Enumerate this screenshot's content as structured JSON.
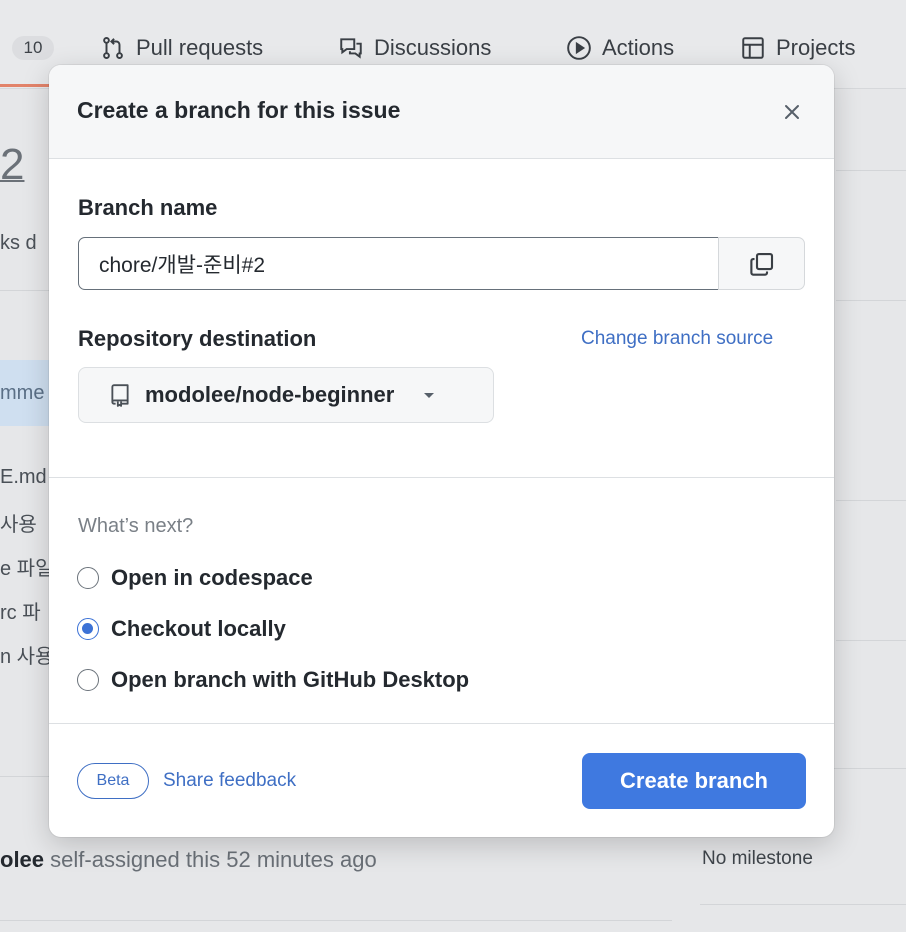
{
  "background": {
    "nav": {
      "count_badge": "10",
      "items": [
        {
          "label": "Pull requests",
          "icon": "git-pull-request-icon"
        },
        {
          "label": "Discussions",
          "icon": "comment-discussion-icon"
        },
        {
          "label": "Actions",
          "icon": "play-icon"
        },
        {
          "label": "Projects",
          "icon": "table-icon"
        }
      ]
    },
    "issue_number_fragment": "2",
    "fragments": {
      "tasks": "ks d",
      "comment_tab": "mme",
      "file_md": "E.md",
      "line_ko_1": "사용",
      "line_ko_2": "e 파일",
      "line_ko_3": "rc 파",
      "line_ko_4": "n 사용"
    },
    "activity": {
      "actor": "olee",
      "text": "self-assigned this 52 minutes ago"
    },
    "milestone": "No milestone"
  },
  "modal": {
    "title": "Create a branch for this issue",
    "branch_name": {
      "label": "Branch name",
      "value": "chore/개발-준비#2"
    },
    "repository": {
      "label": "Repository destination",
      "change_source_link": "Change branch source",
      "selected_repo": "modolee/node-beginner"
    },
    "whats_next": {
      "label": "What’s next?",
      "options": [
        {
          "label": "Open in codespace",
          "checked": false
        },
        {
          "label": "Checkout locally",
          "checked": true
        },
        {
          "label": "Open branch with GitHub Desktop",
          "checked": false
        }
      ]
    },
    "footer": {
      "beta_badge": "Beta",
      "feedback_link": "Share feedback",
      "create_button": "Create branch"
    }
  },
  "colors": {
    "primary_button": "#3f79e0",
    "link": "#3f6fc4",
    "radio_checked": "#3c72d6"
  }
}
